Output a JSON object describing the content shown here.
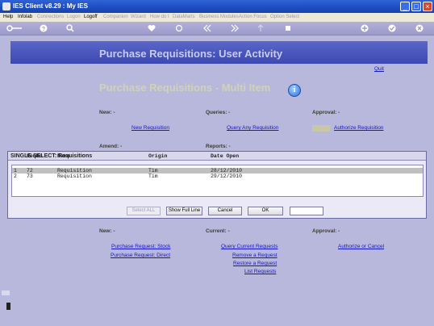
{
  "window": {
    "title": "IES Client v8.29 : My IES",
    "minimize": "_",
    "maximize": "□",
    "close": "×"
  },
  "menu": [
    {
      "label": "Help",
      "enabled": true
    },
    {
      "label": "Infolab",
      "enabled": true
    },
    {
      "label": "Connections",
      "enabled": false
    },
    {
      "label": "Logon",
      "enabled": false
    },
    {
      "label": "Logoff",
      "enabled": true
    },
    {
      "label": "Companion",
      "enabled": false
    },
    {
      "label": "Wizard",
      "enabled": false
    },
    {
      "label": "How do I",
      "enabled": false
    },
    {
      "label": "DataMarts",
      "enabled": false
    },
    {
      "label": "Business Modules",
      "enabled": false
    },
    {
      "label": "Action Focus",
      "enabled": false
    },
    {
      "label": "Option Select",
      "enabled": false
    }
  ],
  "toolbar": {
    "icons": [
      "key-icon",
      "help-icon",
      "search-icon",
      "heart-icon",
      "refresh-icon",
      "back-icon",
      "forward-icon",
      "upload-icon",
      "stop-icon",
      "add-icon",
      "check-icon",
      "close-icon"
    ]
  },
  "page": {
    "banner_title": "Purchase Requisitions: User Activity",
    "quit": "Quit",
    "subtitle": "Purchase Requisitions - Multi Item",
    "info": "i"
  },
  "top_sections": {
    "new_label": "New: -",
    "queries_label": "Queries: -",
    "approval_label": "Approval: -",
    "new_requisition": "New Requisition",
    "query_any_requisition": "Query Any Requisition",
    "authorize_requisition": "Authorize Requisition",
    "amend_label": "Amend: -",
    "reports_label": "Reports: -"
  },
  "dialog": {
    "title": "SINGLE SELECT: Requisitions",
    "columns": [
      "ReqNo",
      "Name",
      "Origin",
      "Date Open"
    ],
    "rows": [
      {
        "idx": "1",
        "reqno": "72",
        "name": "Requisition",
        "origin": "Tim",
        "date_open": "28/12/2010"
      },
      {
        "idx": "2",
        "reqno": "73",
        "name": "Requisition",
        "origin": "Tim",
        "date_open": "29/12/2010"
      }
    ],
    "select_all": "Select ALL",
    "show_full_line": "Show Full Line",
    "cancel": "Cancel",
    "ok": "OK",
    "input_value": ""
  },
  "bottom_sections": {
    "new_label": "New: -",
    "current_label": "Current: -",
    "approval_label": "Approval: -",
    "purchase_request_stock": "Purchase Request: Stock",
    "purchase_request_direct": "Purchase Request: Direct",
    "query_current_requests": "Query Current Requests",
    "remove_a_request": "Remove a Request",
    "restore_a_request": "Restore a Request",
    "list_requests": "List Requests",
    "authorize_or_cancel": "Authorize or Cancel"
  },
  "colors": {
    "background": "#b8b8dc",
    "banner": "#4a54bd",
    "link": "#1515c8",
    "titlebar": "#2356cf"
  }
}
